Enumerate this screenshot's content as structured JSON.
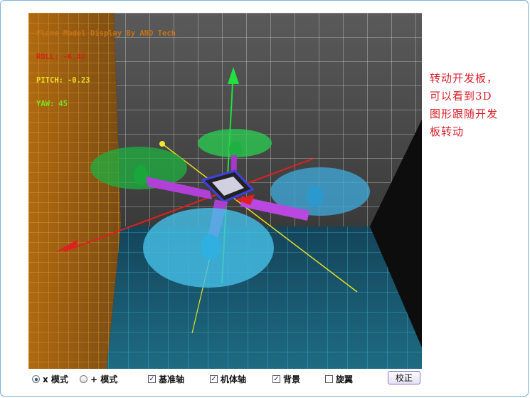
{
  "hud": {
    "title": "Plane Model Display By ANO Tech",
    "roll_label": "ROLL:",
    "roll_value": "-6.42",
    "pitch_label": "PITCH:",
    "pitch_value": "-0.23",
    "yaw_label": "YAW:",
    "yaw_value": "45"
  },
  "note": {
    "lines": [
      "转动开发板，",
      "可以看到3D",
      "图形跟随开发",
      "板转动"
    ]
  },
  "controls": {
    "x_mode": "x 模式",
    "plus_mode": "+ 模式",
    "ref_axis": "基准轴",
    "body_axis": "机体轴",
    "background": "背景",
    "rotor": "旋翼",
    "calibrate": "校正"
  },
  "colors": {
    "accent": "#d8202a",
    "hud_title": "#c87314",
    "frame_border": "#7fb3d9"
  }
}
